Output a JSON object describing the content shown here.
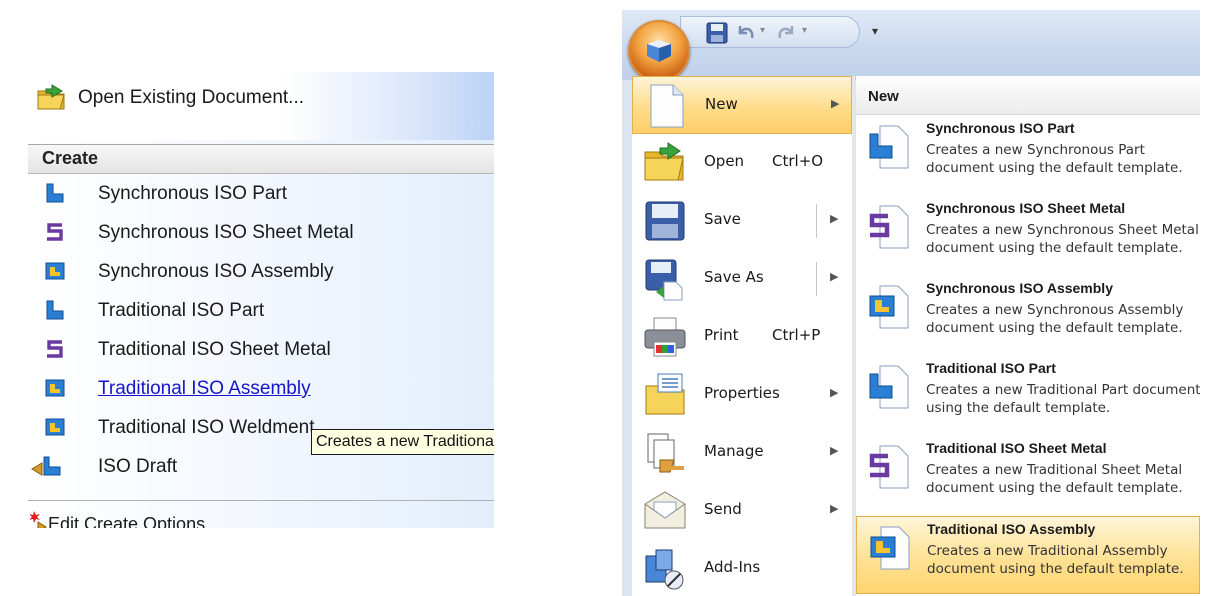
{
  "left_panel": {
    "open_existing": "Open Existing Document...",
    "create_header": "Create",
    "items": [
      {
        "label": "Synchronous ISO Part",
        "icon": "part-icon"
      },
      {
        "label": "Synchronous ISO Sheet Metal",
        "icon": "sheet-metal-icon"
      },
      {
        "label": "Synchronous ISO Assembly",
        "icon": "assembly-icon"
      },
      {
        "label": "Traditional ISO Part",
        "icon": "part-icon"
      },
      {
        "label": "Traditional ISO Sheet Metal",
        "icon": "sheet-metal-icon"
      },
      {
        "label": "Traditional ISO Assembly",
        "icon": "assembly-icon"
      },
      {
        "label": "Traditional ISO Weldment",
        "icon": "weldment-icon"
      },
      {
        "label": "ISO Draft",
        "icon": "draft-icon"
      }
    ],
    "tooltip": "Creates a new Traditional ISO Assembly",
    "edit_create_options": "Edit Create Options"
  },
  "application_menu": {
    "commands": [
      {
        "label": "New",
        "shortcut": "",
        "has_submenu": true,
        "icon": "new-document-icon"
      },
      {
        "label": "Open",
        "shortcut": "Ctrl+O",
        "has_submenu": false,
        "icon": "open-folder-icon"
      },
      {
        "label": "Save",
        "shortcut": "",
        "has_submenu": true,
        "icon": "save-icon"
      },
      {
        "label": "Save As",
        "shortcut": "",
        "has_submenu": true,
        "icon": "save-as-icon"
      },
      {
        "label": "Print",
        "shortcut": "Ctrl+P",
        "has_submenu": false,
        "icon": "printer-icon"
      },
      {
        "label": "Properties",
        "shortcut": "",
        "has_submenu": true,
        "icon": "properties-icon"
      },
      {
        "label": "Manage",
        "shortcut": "",
        "has_submenu": true,
        "icon": "manage-icon"
      },
      {
        "label": "Send",
        "shortcut": "",
        "has_submenu": true,
        "icon": "send-envelope-icon"
      },
      {
        "label": "Add-Ins",
        "shortcut": "",
        "has_submenu": false,
        "icon": "add-ins-icon"
      }
    ],
    "new_submenu": {
      "header": "New",
      "items": [
        {
          "title": "Synchronous ISO Part",
          "description": "Creates a new Synchronous Part document using the default template.",
          "icon": "part-doc-icon"
        },
        {
          "title": "Synchronous ISO Sheet Metal",
          "description": "Creates a new Synchronous Sheet Metal document using the default template.",
          "icon": "sheet-metal-doc-icon"
        },
        {
          "title": "Synchronous ISO Assembly",
          "description": "Creates a new Synchronous Assembly document using the default template.",
          "icon": "assembly-doc-icon"
        },
        {
          "title": "Traditional ISO Part",
          "description": "Creates a new Traditional Part document using the default template.",
          "icon": "part-doc-icon"
        },
        {
          "title": "Traditional ISO Sheet Metal",
          "description": "Creates a new Traditional Sheet Metal document using the default template.",
          "icon": "sheet-metal-doc-icon"
        },
        {
          "title": "Traditional ISO Assembly",
          "description": "Creates a new Traditional Assembly document using the default template.",
          "icon": "assembly-doc-icon"
        }
      ]
    }
  },
  "colors": {
    "link": "#1515cc",
    "highlight": "#ffdc8a",
    "part_blue": "#2a7fd4",
    "sheet_purple": "#6a3aa0",
    "assembly_yellow": "#f4c430"
  }
}
